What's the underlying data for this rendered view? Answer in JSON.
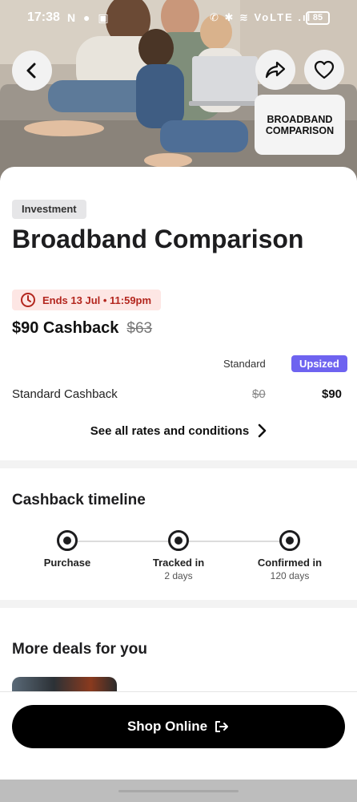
{
  "status_bar": {
    "time": "17:38",
    "left_icons": "N ● ▣",
    "right_icons": "✆ ✱ ≋ VoLTE .ıl",
    "battery": "85"
  },
  "hero": {
    "back_icon": "chevron-left-icon",
    "share_icon": "share-icon",
    "favorite_icon": "heart-icon",
    "logo_text": "BROADBAND COMPARISON"
  },
  "offer": {
    "category_tag": "Investment",
    "title": "Broadband Comparison",
    "ends_text": "Ends 13 Jul • 11:59pm",
    "cashback_current": "$90 Cashback",
    "cashback_previous": "$63"
  },
  "rates": {
    "col_standard": "Standard",
    "col_upsized": "Upsized",
    "row_label": "Standard Cashback",
    "row_standard_value": "$0",
    "row_upsized_value": "$90",
    "see_all_label": "See all rates and conditions"
  },
  "timeline": {
    "title": "Cashback timeline",
    "steps": [
      {
        "label": "Purchase",
        "sub": ""
      },
      {
        "label": "Tracked in",
        "sub": "2 days"
      },
      {
        "label": "Confirmed in",
        "sub": "120 days"
      }
    ]
  },
  "more_deals": {
    "title": "More deals for you"
  },
  "footer": {
    "shop_label": "Shop Online"
  },
  "colors": {
    "accent": "#6e63f0",
    "ends_text": "#b3261e",
    "ends_bg": "#fde6e4",
    "button_bg": "#000000"
  }
}
